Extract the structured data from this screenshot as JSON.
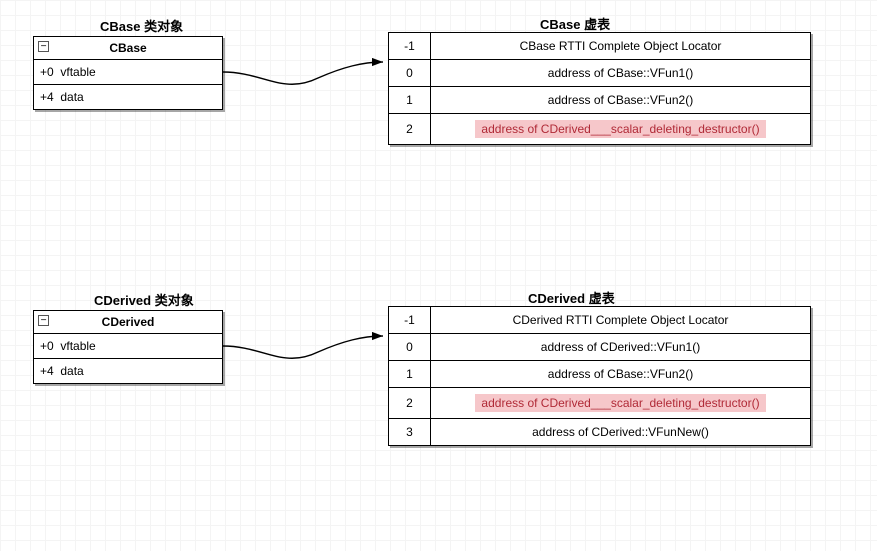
{
  "cbase": {
    "object_title": "CBase 类对象",
    "class_name": "CBase",
    "rows": [
      {
        "offset": "+0",
        "field": "vftable"
      },
      {
        "offset": "+4",
        "field": "data"
      }
    ],
    "vtable_title": "CBase 虚表",
    "vtable": [
      {
        "index": "-1",
        "entry": "CBase RTTI Complete Object Locator",
        "highlight": false
      },
      {
        "index": "0",
        "entry": "address of CBase::VFun1()",
        "highlight": false
      },
      {
        "index": "1",
        "entry": "address of CBase::VFun2()",
        "highlight": false
      },
      {
        "index": "2",
        "entry": "address of CDerived___scalar_deleting_destructor()",
        "highlight": true
      }
    ]
  },
  "cderived": {
    "object_title": "CDerived 类对象",
    "class_name": "CDerived",
    "rows": [
      {
        "offset": "+0",
        "field": "vftable"
      },
      {
        "offset": "+4",
        "field": "data"
      }
    ],
    "vtable_title": "CDerived 虚表",
    "vtable": [
      {
        "index": "-1",
        "entry": "CDerived RTTI Complete Object Locator",
        "highlight": false
      },
      {
        "index": "0",
        "entry": "address of CDerived::VFun1()",
        "highlight": false
      },
      {
        "index": "1",
        "entry": "address of CBase::VFun2()",
        "highlight": false
      },
      {
        "index": "2",
        "entry": "address of CDerived___scalar_deleting_destructor()",
        "highlight": true
      },
      {
        "index": "3",
        "entry": "address of CDerived::VFunNew()",
        "highlight": false
      }
    ]
  },
  "icons": {
    "collapse": "−"
  }
}
